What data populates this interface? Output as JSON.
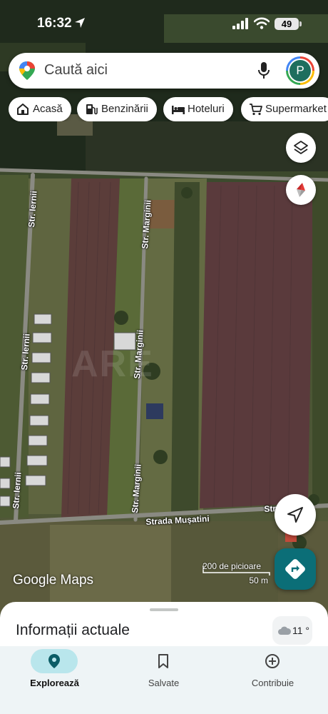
{
  "status_bar": {
    "time": "16:32",
    "battery": "49"
  },
  "search": {
    "placeholder": "Caută aici",
    "avatar_letter": "P"
  },
  "chips": [
    {
      "label": "Acasă",
      "icon": "home-icon"
    },
    {
      "label": "Benzinării",
      "icon": "gas-station-icon"
    },
    {
      "label": "Hoteluri",
      "icon": "bed-icon"
    },
    {
      "label": "Supermarket",
      "icon": "cart-icon"
    }
  ],
  "map": {
    "streets": {
      "ierrnii_top": "Str. Iernii",
      "ierrnii_mid": "Str. Iernii",
      "ierrnii_bottom": "Str. Iernii",
      "marginii_top": "Str. Marginii",
      "marginii_mid": "Str. Marginii",
      "marginii_bottom": "Str. Marginii",
      "musatini": "Strada Mușatini",
      "right_fragment": "Str"
    },
    "watermark": "ARE",
    "google_logo": "Google Maps",
    "scale": {
      "imperial": "200 de picioare",
      "metric": "50 m"
    }
  },
  "sheet": {
    "title": "Informații actuale",
    "weather": "11 °"
  },
  "bottom_nav": [
    {
      "label": "Explorează",
      "icon": "location-pin-icon",
      "active": true
    },
    {
      "label": "Salvate",
      "icon": "bookmark-icon",
      "active": false
    },
    {
      "label": "Contribuie",
      "icon": "add-circle-icon",
      "active": false
    }
  ],
  "colors": {
    "accent": "#0b6e77",
    "active_pill": "#b9e6ec"
  }
}
